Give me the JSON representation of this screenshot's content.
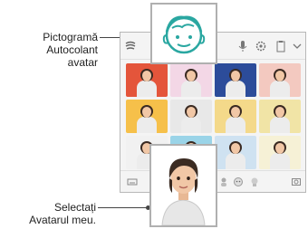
{
  "callouts": {
    "avatar_sticker_icon": [
      "Pictogramă",
      "Autocolant",
      "avatar"
    ],
    "select_my_avatar": [
      "Selectați",
      "Avatarul meu."
    ]
  },
  "colors": {
    "accent_teal": "#2aa7a1",
    "frame_gray": "#b0b0b0",
    "keyboard_bg": "#f4f4f4"
  },
  "toolbar": {
    "icons": [
      "sticker-icon",
      "avatar-sticker-icon",
      "mic-icon",
      "settings-icon",
      "clipboard-icon",
      "collapse-chevron-icon"
    ]
  },
  "bottom_bar": {
    "icons": [
      "keyboard-icon",
      "avatar-face-icon",
      "sticker-category-icon",
      "sticker-category-icon-2",
      "sticker-category-icon-3",
      "ar-camera-icon"
    ]
  }
}
